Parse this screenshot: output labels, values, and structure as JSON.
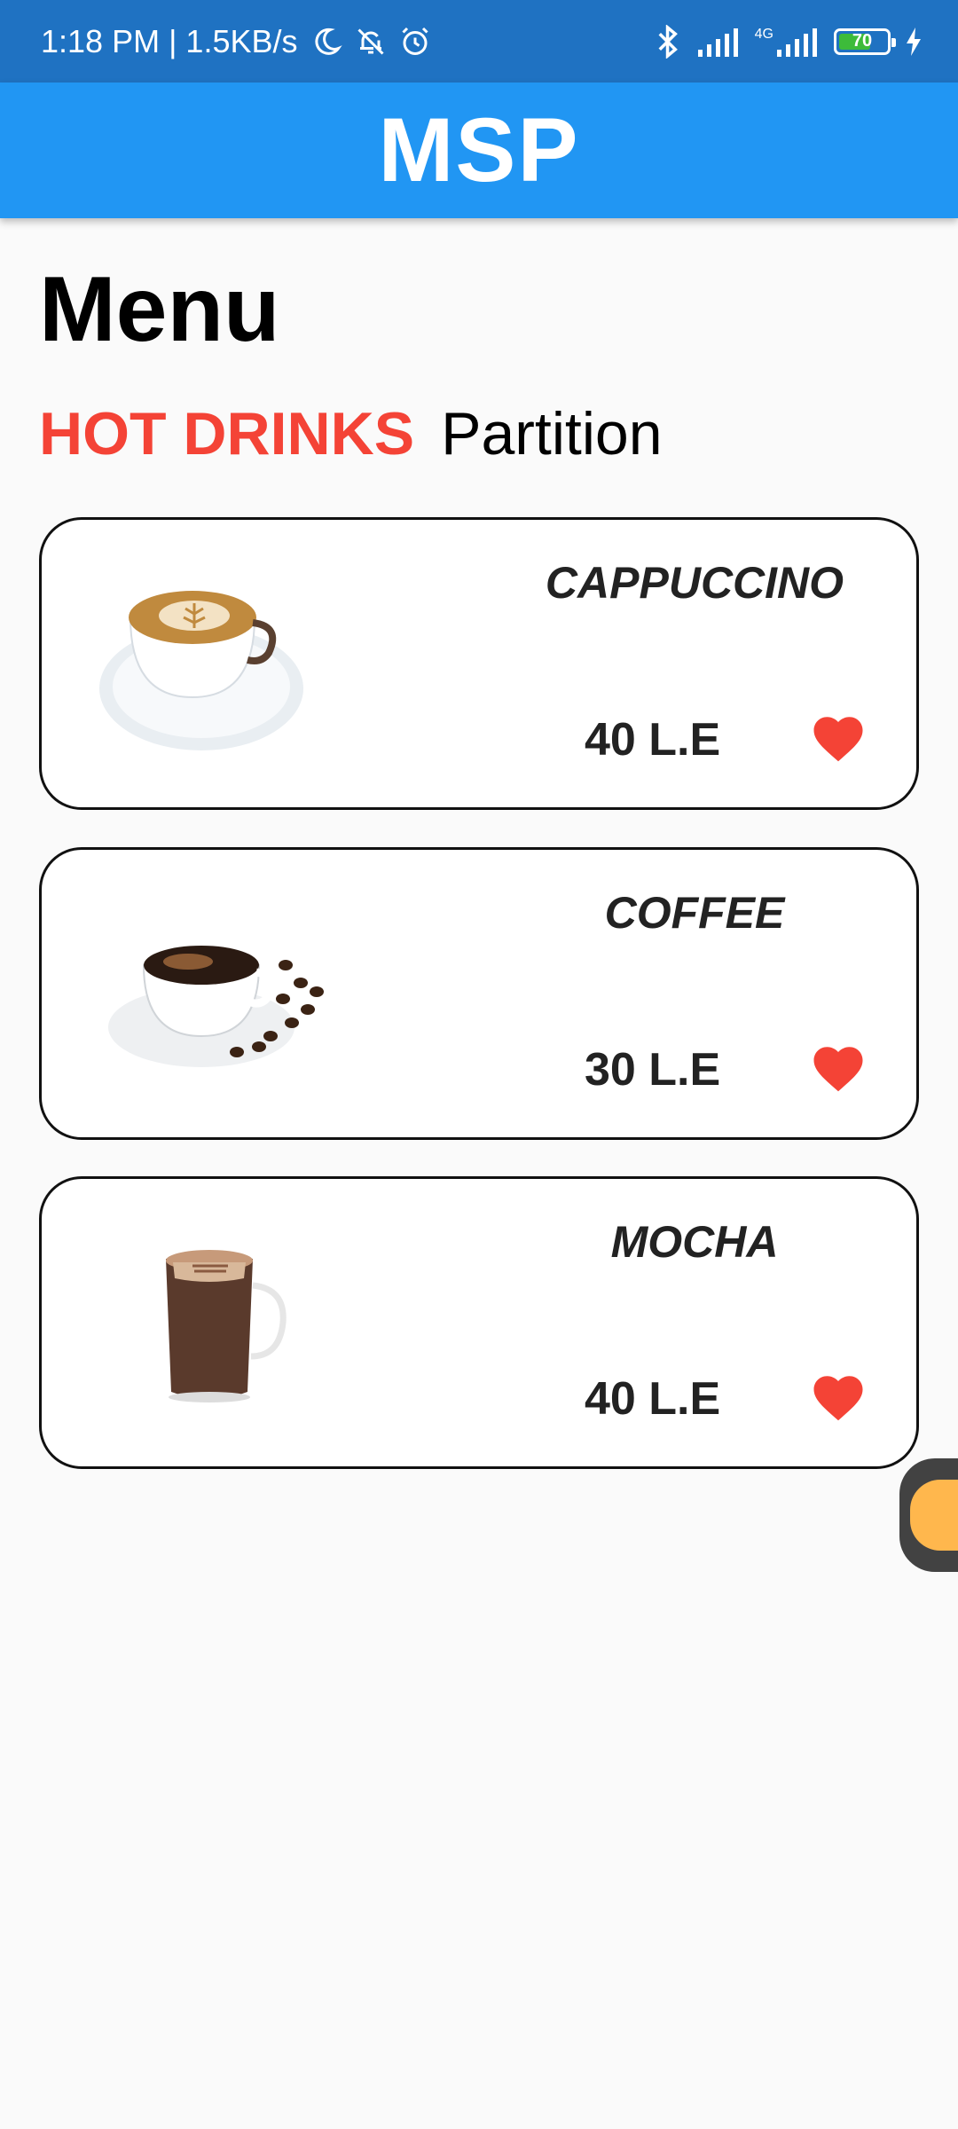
{
  "status_bar": {
    "time": "1:18 PM | 1.5KB/s",
    "network": "4G",
    "battery": "70"
  },
  "app_bar": {
    "title": "MSP"
  },
  "page": {
    "title": "Menu",
    "section_highlight": "HOT DRINKS",
    "section_rest": "Partition"
  },
  "items": [
    {
      "name": "CAPPUCCINO",
      "price": "40 L.E",
      "icon": "cappuccino-cup-image"
    },
    {
      "name": "COFFEE",
      "price": "30 L.E",
      "icon": "coffee-cup-beans-image"
    },
    {
      "name": "MOCHA",
      "price": "40 L.E",
      "icon": "mocha-glass-mug-image"
    }
  ],
  "colors": {
    "status_bar": "#1f72c2",
    "app_bar": "#2196f3",
    "accent_red": "#f44336",
    "background": "#fafafa"
  }
}
